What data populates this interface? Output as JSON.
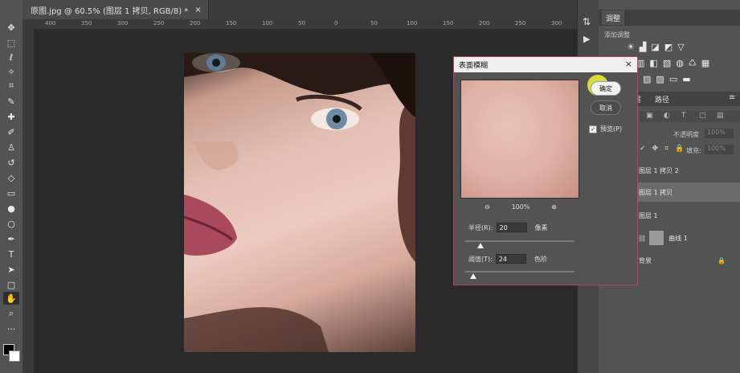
{
  "document_tab": {
    "title": "原图.jpg @ 60.5% (图层 1 拷贝, RGB/8) *",
    "close": "×"
  },
  "ruler": {
    "ticks": [
      "400",
      "350",
      "300",
      "250",
      "200",
      "150",
      "100",
      "50",
      "0",
      "50",
      "100",
      "150",
      "200",
      "250",
      "300"
    ]
  },
  "tools": [
    "move",
    "marquee",
    "lasso",
    "magic-wand",
    "crop",
    "eyedropper",
    "healing",
    "brush",
    "stamp",
    "history-brush",
    "eraser",
    "gradient",
    "blur",
    "dodge",
    "pen",
    "type",
    "path-select",
    "rectangle",
    "hand",
    "zoom",
    "more",
    "colors"
  ],
  "panels": {
    "adjustments_tab": "调整",
    "adjustments_subtitle": "添加调整",
    "paths_tab": "路径"
  },
  "layers_panel": {
    "fill_label": "填充:",
    "fill_value": "100%",
    "opacity_value": "100%",
    "opacity_label": "不透明度",
    "layers": [
      {
        "name": "图层 1 拷贝 2",
        "selected": false
      },
      {
        "name": "图层 1 拷贝",
        "selected": true
      },
      {
        "name": "图层 1",
        "selected": false
      },
      {
        "name": "曲线 1",
        "selected": false
      },
      {
        "name": "背景",
        "selected": false
      }
    ]
  },
  "dialog": {
    "title": "表面模糊",
    "close": "×",
    "ok_label": "确定",
    "cancel_label": "取消",
    "preview_label": "预览(P)",
    "preview_checked": true,
    "zoom_out": "⊖",
    "zoom_level": "100%",
    "zoom_in": "⊕",
    "radius": {
      "label": "半径(R):",
      "value": "20",
      "unit": "像素",
      "slider_fraction": 0.14
    },
    "threshold": {
      "label": "阈值(T):",
      "value": "24",
      "unit": "色阶",
      "slider_fraction": 0.07
    }
  }
}
